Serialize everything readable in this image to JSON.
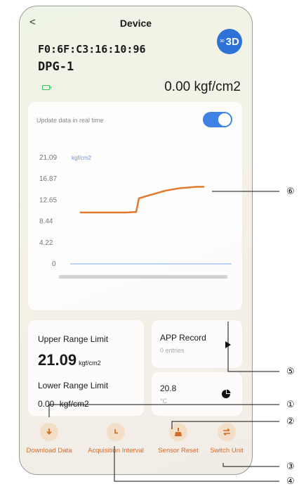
{
  "header": {
    "back": "<",
    "title": "Device",
    "badge_small": "3D",
    "badge": "3D"
  },
  "device": {
    "mac": "F0:6F:C3:16:10:96",
    "name": "DPG-1",
    "reading": "0.00 kgf/cm2",
    "battery_color": "#39c05c"
  },
  "realtime": {
    "label": "Update data in real time",
    "enabled": true
  },
  "chart_data": {
    "type": "line",
    "ylabel": "kgf/cm2",
    "y_ticks": [
      "21.09",
      "16.87",
      "12.65",
      "8.44",
      "4.22",
      "0"
    ],
    "ylim": [
      0,
      21.09
    ],
    "grid": false,
    "series": [
      {
        "color": "#e07a2e",
        "values": [
          10.2,
          10.2,
          10.2,
          10.2,
          10.3,
          13.0,
          13.5,
          14.5,
          15.0,
          15.3,
          15.3
        ]
      },
      {
        "color": "#7da9e8",
        "values": [
          0,
          0
        ]
      }
    ]
  },
  "range": {
    "upper_label": "Upper Range Limit",
    "upper_value": "21.09",
    "upper_unit": "kgf/cm2",
    "lower_label": "Lower Range Limit",
    "lower_value": "0.00",
    "lower_unit": "kgf/cm2"
  },
  "app_record": {
    "label": "APP Record",
    "count": "0 entries"
  },
  "temperature": {
    "value": "20.8",
    "unit": "°C"
  },
  "toolbar": {
    "download": "Download Data",
    "interval": "Acquisition Interval",
    "reset": "Sensor Reset",
    "switch": "Switch Unit"
  },
  "annotations": [
    "⑥",
    "⑤",
    "①",
    "②",
    "③",
    "④"
  ],
  "colors": {
    "accent": "#3e82e4",
    "tool": "#d76a28",
    "tool_bg": "#f3dfc8"
  }
}
